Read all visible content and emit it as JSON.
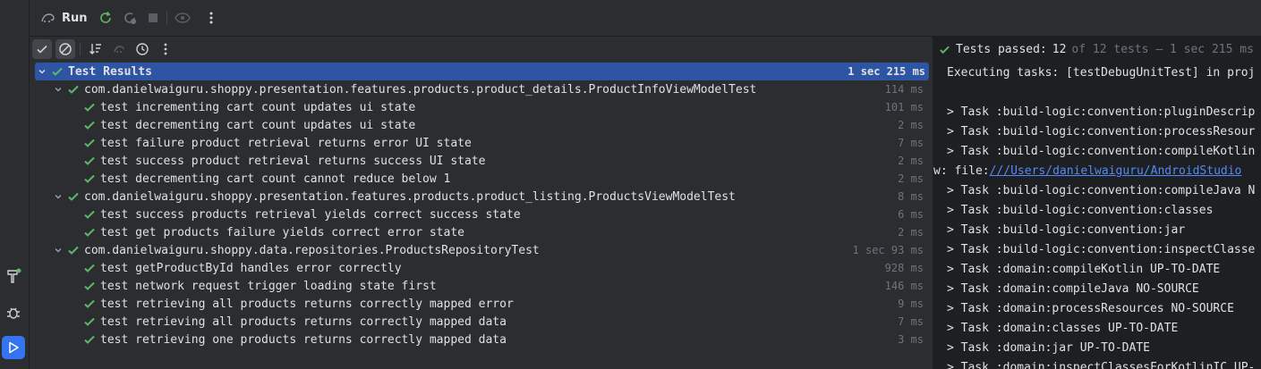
{
  "header": {
    "run_label": "Run"
  },
  "tree": {
    "root": {
      "label": "Test Results",
      "duration": "1 sec 215 ms"
    },
    "rows": [
      {
        "level": 1,
        "label": "com.danielwaiguru.shoppy.presentation.features.products.product_details.ProductInfoViewModelTest",
        "duration": "114 ms"
      },
      {
        "level": 2,
        "label": "test incrementing cart count updates ui state",
        "duration": "101 ms"
      },
      {
        "level": 2,
        "label": "test decrementing cart count updates ui state",
        "duration": "2 ms"
      },
      {
        "level": 2,
        "label": "test failure product retrieval returns error UI state",
        "duration": "7 ms"
      },
      {
        "level": 2,
        "label": "test success product retrieval returns success UI state",
        "duration": "2 ms"
      },
      {
        "level": 2,
        "label": "test decrementing cart count cannot reduce below 1",
        "duration": "2 ms"
      },
      {
        "level": 1,
        "label": "com.danielwaiguru.shoppy.presentation.features.products.product_listing.ProductsViewModelTest",
        "duration": "8 ms"
      },
      {
        "level": 2,
        "label": "test success products retrieval yields correct success state",
        "duration": "6 ms"
      },
      {
        "level": 2,
        "label": "test get products failure yields correct error state",
        "duration": "2 ms"
      },
      {
        "level": 1,
        "label": "com.danielwaiguru.shoppy.data.repositories.ProductsRepositoryTest",
        "duration": "1 sec 93 ms"
      },
      {
        "level": 2,
        "label": "test getProductById handles error correctly",
        "duration": "928 ms"
      },
      {
        "level": 2,
        "label": "test network request trigger loading state first",
        "duration": "146 ms"
      },
      {
        "level": 2,
        "label": "test retrieving all products returns correctly mapped error",
        "duration": "9 ms"
      },
      {
        "level": 2,
        "label": "test retrieving all products returns correctly mapped data",
        "duration": "7 ms"
      },
      {
        "level": 2,
        "label": "test retrieving one products returns correctly mapped data",
        "duration": "3 ms"
      }
    ]
  },
  "status": {
    "passed_label": "Tests passed:",
    "passed_count": "12",
    "summary": "of 12 tests – 1 sec 215 ms"
  },
  "console": {
    "lines": [
      "Executing tasks: [testDebugUnitTest] in proj",
      "",
      "> Task :build-logic:convention:pluginDescrip",
      "> Task :build-logic:convention:processResour",
      "> Task :build-logic:convention:compileKotlin",
      "",
      "> Task :build-logic:convention:compileJava N",
      "> Task :build-logic:convention:classes",
      "> Task :build-logic:convention:jar",
      "> Task :build-logic:convention:inspectClasse",
      "> Task :domain:compileKotlin UP-TO-DATE",
      "> Task :domain:compileJava NO-SOURCE",
      "> Task :domain:processResources NO-SOURCE",
      "> Task :domain:classes UP-TO-DATE",
      "> Task :domain:jar UP-TO-DATE",
      "> Task :domain:inspectClassesForKotlinIC UP-"
    ],
    "warning_prefix": "w: file:",
    "warning_link": "///Users/danielwaiguru/AndroidStudio"
  },
  "colors": {
    "pass_green": "#5fb865",
    "selection": "#2e55a3",
    "accent": "#3574f0",
    "link": "#548af7"
  },
  "icons": [
    "hammer-icon",
    "bug-icon",
    "run-icon",
    "rerun-icon",
    "rerun-failed-icon",
    "stop-icon",
    "eye-icon",
    "more-icon",
    "show-passed-icon",
    "show-ignored-icon",
    "sort-icon",
    "import-icon",
    "history-icon",
    "check-icon",
    "chevron-down-icon"
  ]
}
